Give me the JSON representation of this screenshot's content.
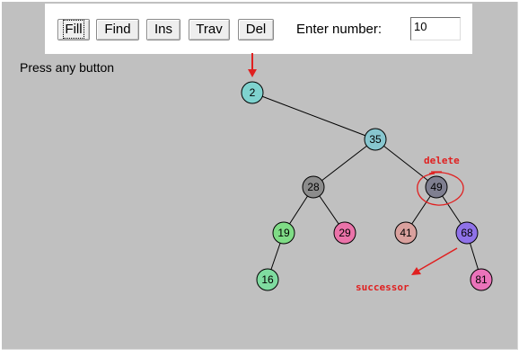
{
  "toolbar": {
    "buttons": [
      {
        "id": "fill",
        "label": "Fill"
      },
      {
        "id": "find",
        "label": "Find"
      },
      {
        "id": "ins",
        "label": "Ins"
      },
      {
        "id": "trav",
        "label": "Trav"
      },
      {
        "id": "del",
        "label": "Del"
      }
    ],
    "enter_label": "Enter number:",
    "number_value": "10"
  },
  "status_text": "Press any button",
  "tree": {
    "nodes": [
      {
        "id": "n2",
        "label": "2",
        "fill": "#7fd3cf"
      },
      {
        "id": "n35",
        "label": "35",
        "fill": "#87c6cf"
      },
      {
        "id": "n28",
        "label": "28",
        "fill": "#8c8c8c"
      },
      {
        "id": "n49",
        "label": "49",
        "fill": "#7f7f90"
      },
      {
        "id": "n19",
        "label": "19",
        "fill": "#7fdc86"
      },
      {
        "id": "n29",
        "label": "29",
        "fill": "#ea73a9"
      },
      {
        "id": "n41",
        "label": "41",
        "fill": "#d9a19e"
      },
      {
        "id": "n68",
        "label": "68",
        "fill": "#8f72e8"
      },
      {
        "id": "n16",
        "label": "16",
        "fill": "#7fdca0"
      },
      {
        "id": "n81",
        "label": "81",
        "fill": "#ea73ba"
      }
    ],
    "edges": [
      [
        "n2",
        "n35"
      ],
      [
        "n35",
        "n28"
      ],
      [
        "n35",
        "n49"
      ],
      [
        "n28",
        "n19"
      ],
      [
        "n28",
        "n29"
      ],
      [
        "n49",
        "n41"
      ],
      [
        "n49",
        "n68"
      ],
      [
        "n19",
        "n16"
      ],
      [
        "n68",
        "n81"
      ]
    ]
  },
  "annotations": {
    "delete_text": "delete",
    "successor_text": "successor",
    "color": "#e02020"
  }
}
